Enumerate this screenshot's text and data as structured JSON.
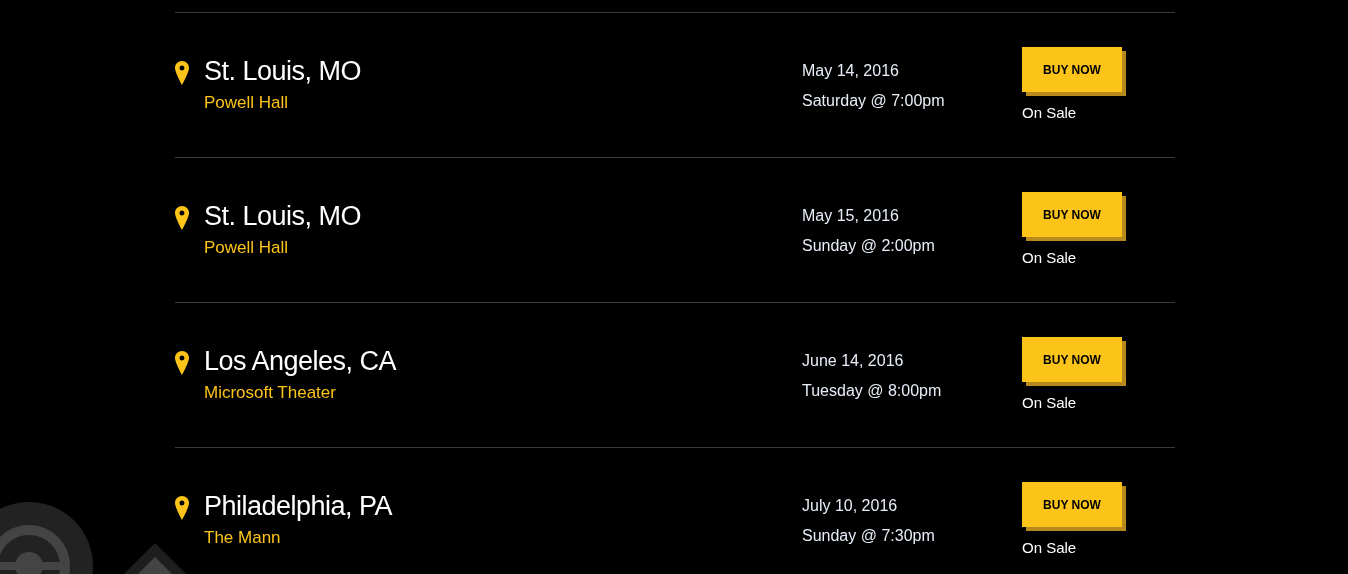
{
  "events": [
    {
      "city": "St. Louis, MO",
      "venue": "Powell Hall",
      "date": "May 14, 2016",
      "time": "Saturday @ 7:00pm",
      "button": "BUY NOW",
      "status": "On Sale"
    },
    {
      "city": "St. Louis, MO",
      "venue": "Powell Hall",
      "date": "May 15, 2016",
      "time": "Sunday @ 2:00pm",
      "button": "BUY NOW",
      "status": "On Sale"
    },
    {
      "city": "Los Angeles, CA",
      "venue": "Microsoft Theater",
      "date": "June 14, 2016",
      "time": "Tuesday @ 8:00pm",
      "button": "BUY NOW",
      "status": "On Sale"
    },
    {
      "city": "Philadelphia, PA",
      "venue": "The Mann",
      "date": "July 10, 2016",
      "time": "Sunday @ 7:30pm",
      "button": "BUY NOW",
      "status": "On Sale"
    }
  ]
}
